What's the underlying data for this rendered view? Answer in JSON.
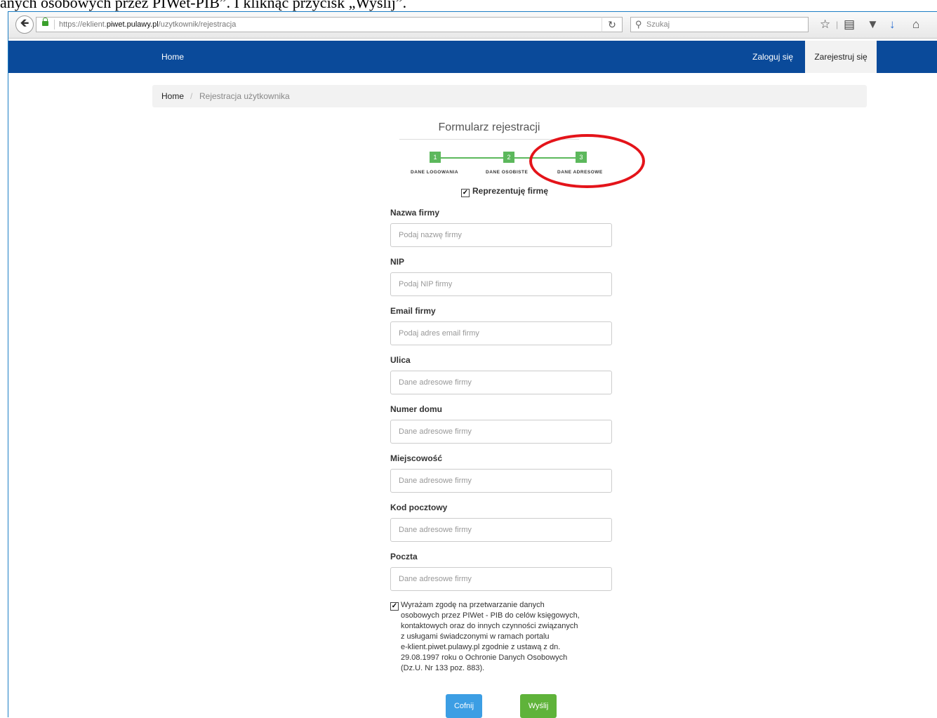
{
  "caption": {
    "text": "anych osobowych przez PIWet-PIB”. I kliknąć przycisk „Wyślij”."
  },
  "browser": {
    "url_prefix": "https://eklient.",
    "url_domain": "piwet.pulawy.pl",
    "url_path": "/uzytkownik/rejestracja",
    "search_placeholder": "Szukaj",
    "icons": [
      "back-arrow-icon",
      "lock-icon",
      "reload-icon",
      "search-icon",
      "bookmark-star-icon",
      "reading-list-icon",
      "pocket-icon",
      "download-icon",
      "home-icon"
    ]
  },
  "nav": {
    "home": "Home",
    "login": "Zaloguj się",
    "register": "Zarejestruj się"
  },
  "breadcrumb": {
    "home": "Home",
    "separator": "/",
    "current": "Rejestracja użytkownika"
  },
  "form": {
    "title": "Formularz rejestracji",
    "steps": [
      {
        "number": "1",
        "label": "DANE LOGOWANIA"
      },
      {
        "number": "2",
        "label": "DANE OSOBISTE"
      },
      {
        "number": "3",
        "label": "DANE ADRESOWE"
      }
    ],
    "represent_company": "Reprezentuję firmę",
    "fields": [
      {
        "label": "Nazwa firmy",
        "placeholder": "Podaj nazwę firmy"
      },
      {
        "label": "NIP",
        "placeholder": "Podaj NIP firmy"
      },
      {
        "label": "Email firmy",
        "placeholder": "Podaj adres email firmy"
      },
      {
        "label": "Ulica",
        "placeholder": "Dane adresowe firmy"
      },
      {
        "label": "Numer domu",
        "placeholder": "Dane adresowe firmy"
      },
      {
        "label": "Miejscowość",
        "placeholder": "Dane adresowe firmy"
      },
      {
        "label": "Kod pocztowy",
        "placeholder": "Dane adresowe firmy"
      },
      {
        "label": "Poczta",
        "placeholder": "Dane adresowe firmy"
      }
    ],
    "consent_lines": [
      "Wyrażam zgodę na przetwarzanie danych",
      "osobowych przez PIWet - PIB do celów księgowych,",
      "kontaktowych oraz do innych czynności związanych",
      "z usługami świadczonymi w ramach portalu",
      "e-klient.piwet.pulawy.pl zgodnie z ustawą z dn.",
      "29.08.1997 roku o Ochronie Danych Osobowych",
      "(Dz.U. Nr 133 poz. 883)."
    ],
    "back_button": "Cofnij",
    "send_button": "Wyślij"
  },
  "colors": {
    "navbar": "#0a4a9a",
    "step_green": "#5cb85c",
    "back_button": "#3c9ee4",
    "send_button": "#5fb33a",
    "annotation_red": "#e4141a"
  }
}
